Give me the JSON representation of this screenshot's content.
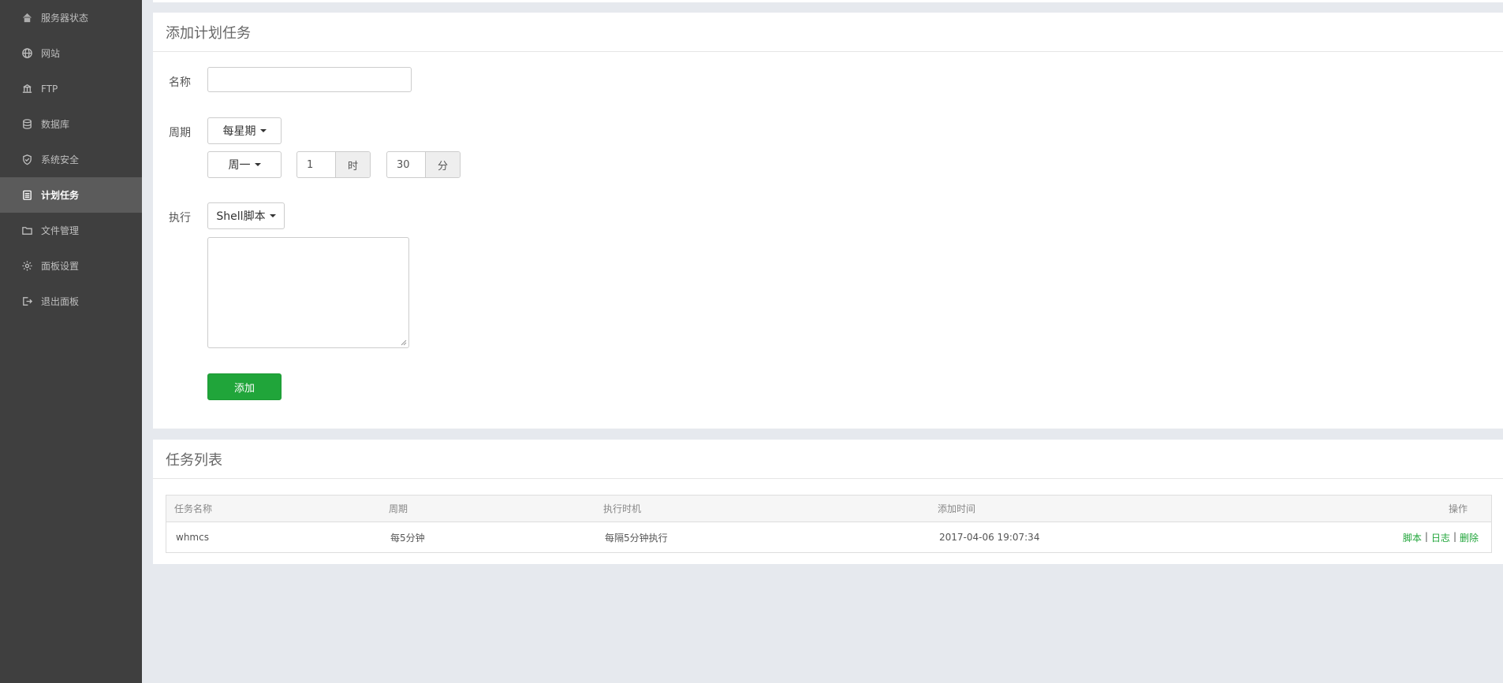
{
  "sidebar": {
    "items": [
      {
        "label": "服务器状态",
        "icon": "home-icon"
      },
      {
        "label": "网站",
        "icon": "globe-icon"
      },
      {
        "label": "FTP",
        "icon": "ftp-icon"
      },
      {
        "label": "数据库",
        "icon": "database-icon"
      },
      {
        "label": "系统安全",
        "icon": "shield-icon"
      },
      {
        "label": "计划任务",
        "icon": "calendar-icon",
        "active": true
      },
      {
        "label": "文件管理",
        "icon": "folder-icon"
      },
      {
        "label": "面板设置",
        "icon": "gear-icon"
      },
      {
        "label": "退出面板",
        "icon": "logout-icon"
      }
    ]
  },
  "add_task": {
    "title": "添加计划任务",
    "name_label": "名称",
    "name_value": "",
    "period_label": "周期",
    "period_value": "每星期",
    "weekday_value": "周一",
    "hour_value": "1",
    "hour_unit": "时",
    "minute_value": "30",
    "minute_unit": "分",
    "exec_label": "执行",
    "exec_type": "Shell脚本",
    "script_value": "",
    "add_button": "添加"
  },
  "task_list": {
    "title": "任务列表",
    "columns": [
      "任务名称",
      "周期",
      "执行时机",
      "添加时间",
      "操作"
    ],
    "rows": [
      {
        "name": "whmcs",
        "period": "每5分钟",
        "timing": "每隔5分钟执行",
        "added": "2017-04-06 19:07:34",
        "ops": [
          "脚本",
          "日志",
          "删除"
        ]
      }
    ]
  },
  "colors": {
    "sidebar_bg": "#3f3f3f",
    "sidebar_active": "#5b5b5b",
    "accent_green": "#20a53a",
    "page_bg": "#e6e9ee"
  }
}
